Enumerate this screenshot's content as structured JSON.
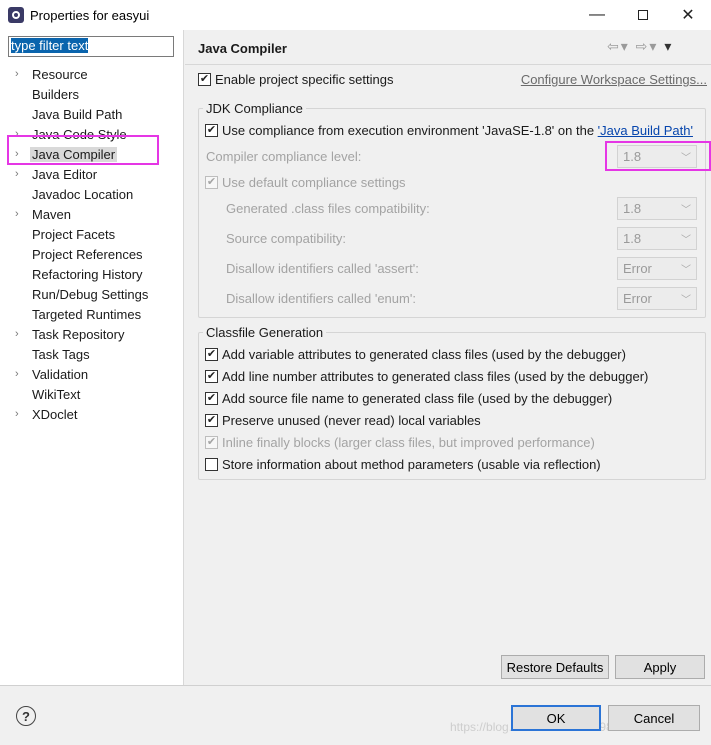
{
  "window": {
    "title": "Properties for easyui",
    "minimize": "—",
    "close": "✕"
  },
  "filter": {
    "value": "type filter text"
  },
  "tree": [
    {
      "label": "Resource",
      "expandable": true
    },
    {
      "label": "Builders",
      "expandable": false
    },
    {
      "label": "Java Build Path",
      "expandable": false
    },
    {
      "label": "Java Code Style",
      "expandable": true
    },
    {
      "label": "Java Compiler",
      "expandable": true,
      "selected": true
    },
    {
      "label": "Java Editor",
      "expandable": true
    },
    {
      "label": "Javadoc Location",
      "expandable": false
    },
    {
      "label": "Maven",
      "expandable": true
    },
    {
      "label": "Project Facets",
      "expandable": false
    },
    {
      "label": "Project References",
      "expandable": false
    },
    {
      "label": "Refactoring History",
      "expandable": false
    },
    {
      "label": "Run/Debug Settings",
      "expandable": false
    },
    {
      "label": "Targeted Runtimes",
      "expandable": false
    },
    {
      "label": "Task Repository",
      "expandable": true
    },
    {
      "label": "Task Tags",
      "expandable": false
    },
    {
      "label": "Validation",
      "expandable": true
    },
    {
      "label": "WikiText",
      "expandable": false
    },
    {
      "label": "XDoclet",
      "expandable": true
    }
  ],
  "page": {
    "title": "Java Compiler",
    "enable_specific": "Enable project specific settings",
    "configure_ws": "Configure Workspace Settings..."
  },
  "jdk": {
    "group_title": "JDK Compliance",
    "use_compliance_text": "Use compliance from execution environment 'JavaSE-1.8' on the ",
    "build_path_link": "'Java Build Path'",
    "compliance_level_label": "Compiler compliance level:",
    "compliance_level_value": "1.8",
    "use_default": "Use default compliance settings",
    "generated_label": "Generated .class files compatibility:",
    "generated_value": "1.8",
    "source_label": "Source compatibility:",
    "source_value": "1.8",
    "assert_label": "Disallow identifiers called 'assert':",
    "assert_value": "Error",
    "enum_label": "Disallow identifiers called 'enum':",
    "enum_value": "Error"
  },
  "classfile": {
    "group_title": "Classfile Generation",
    "options": [
      {
        "label": "Add variable attributes to generated class files (used by the debugger)",
        "checked": true,
        "disabled": false
      },
      {
        "label": "Add line number attributes to generated class files (used by the debugger)",
        "checked": true,
        "disabled": false
      },
      {
        "label": "Add source file name to generated class file (used by the debugger)",
        "checked": true,
        "disabled": false
      },
      {
        "label": "Preserve unused (never read) local variables",
        "checked": true,
        "disabled": false
      },
      {
        "label": "Inline finally blocks (larger class files, but improved performance)",
        "checked": true,
        "disabled": true
      },
      {
        "label": "Store information about method parameters (usable via reflection)",
        "checked": false,
        "disabled": false
      }
    ]
  },
  "buttons": {
    "restore": "Restore Defaults",
    "apply": "Apply",
    "ok": "OK",
    "cancel": "Cancel"
  },
  "watermark": "https://blog.csdn.net/ZZZ/1998477",
  "colors": {
    "highlight": "#e536e5",
    "selection": "#0a64ad",
    "link": "#0645ad",
    "default_button_border": "#2b74d6"
  }
}
